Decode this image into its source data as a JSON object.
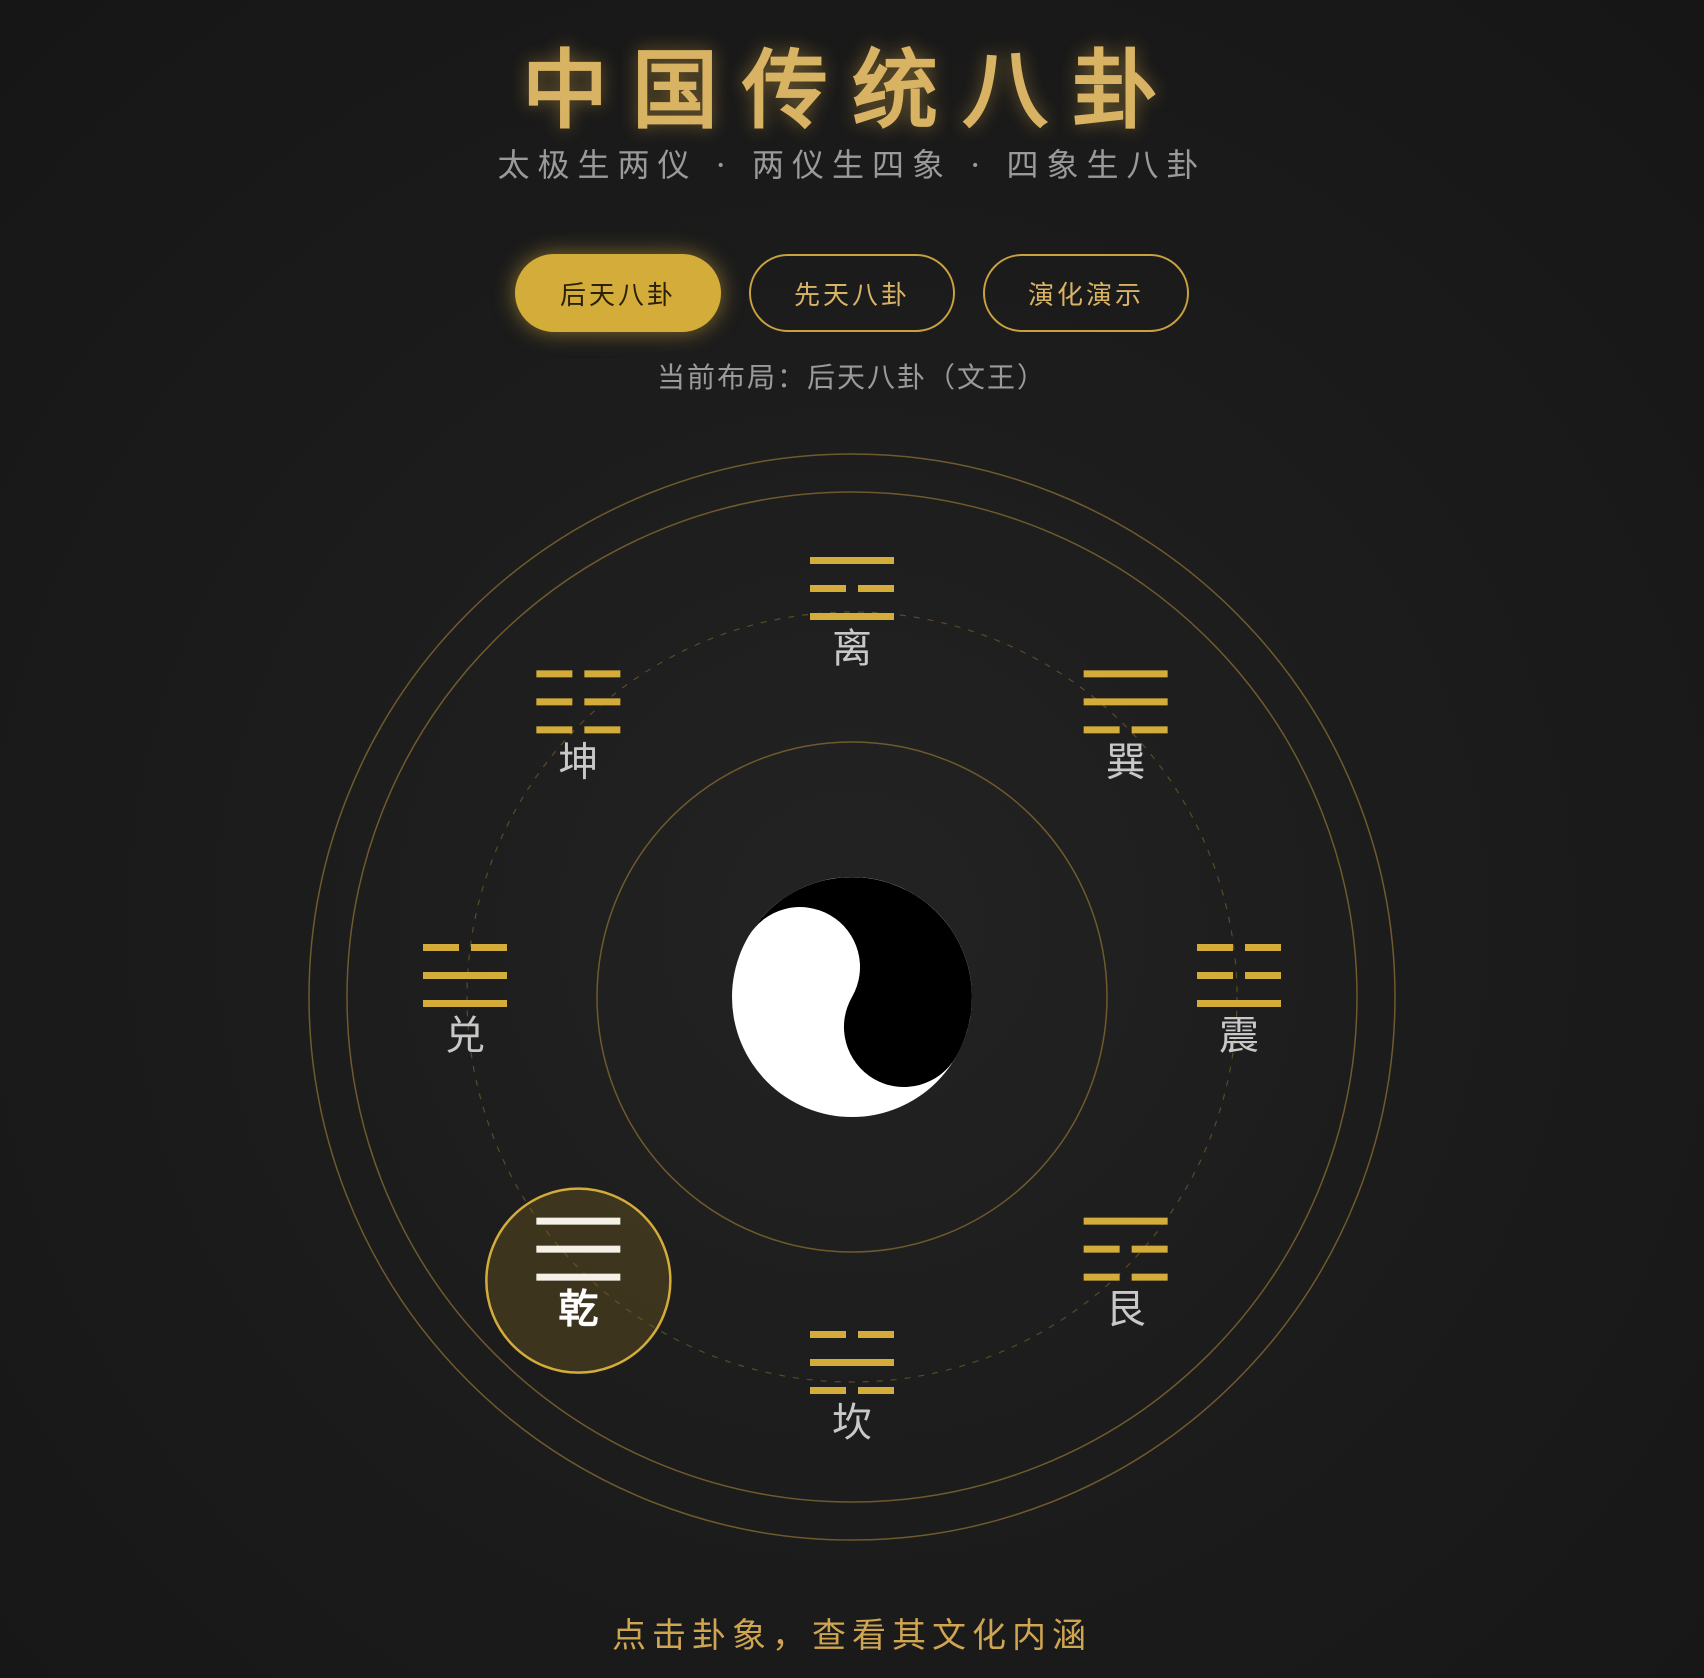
{
  "header": {
    "title": "中国传统八卦",
    "subtitle": "太极生两仪 · 两仪生四象 · 四象生八卦"
  },
  "tabs": [
    {
      "label": "后天八卦",
      "active": true
    },
    {
      "label": "先天八卦",
      "active": false
    },
    {
      "label": "演化演示",
      "active": false
    }
  ],
  "current_layout": {
    "text": "当前布局：后天八卦（文王）"
  },
  "center": {
    "icon": "taiji-yin-yang-icon"
  },
  "trigrams": [
    {
      "key": "li",
      "name": "离",
      "lines": [
        1,
        0,
        1
      ],
      "angle": 0,
      "selected": false
    },
    {
      "key": "kun",
      "name": "坤",
      "lines": [
        0,
        0,
        0
      ],
      "angle": 315,
      "selected": false
    },
    {
      "key": "xun",
      "name": "巽",
      "lines": [
        1,
        1,
        0
      ],
      "angle": 45,
      "selected": false
    },
    {
      "key": "dui",
      "name": "兑",
      "lines": [
        0,
        1,
        1
      ],
      "angle": 270,
      "selected": false
    },
    {
      "key": "zhen",
      "name": "震",
      "lines": [
        0,
        0,
        1
      ],
      "angle": 90,
      "selected": false
    },
    {
      "key": "qian",
      "name": "乾",
      "lines": [
        1,
        1,
        1
      ],
      "angle": 225,
      "selected": true
    },
    {
      "key": "kan",
      "name": "坎",
      "lines": [
        0,
        1,
        0
      ],
      "angle": 180,
      "selected": false
    },
    {
      "key": "gen",
      "name": "艮",
      "lines": [
        1,
        0,
        0
      ],
      "angle": 135,
      "selected": false
    }
  ],
  "colors": {
    "gold": "#d4ac3a",
    "text_gold": "#d9b364",
    "selected_line": "#f5f1e6",
    "label": "#c8c8c8"
  },
  "footer": {
    "hint": "点击卦象，查看其文化内涵"
  }
}
